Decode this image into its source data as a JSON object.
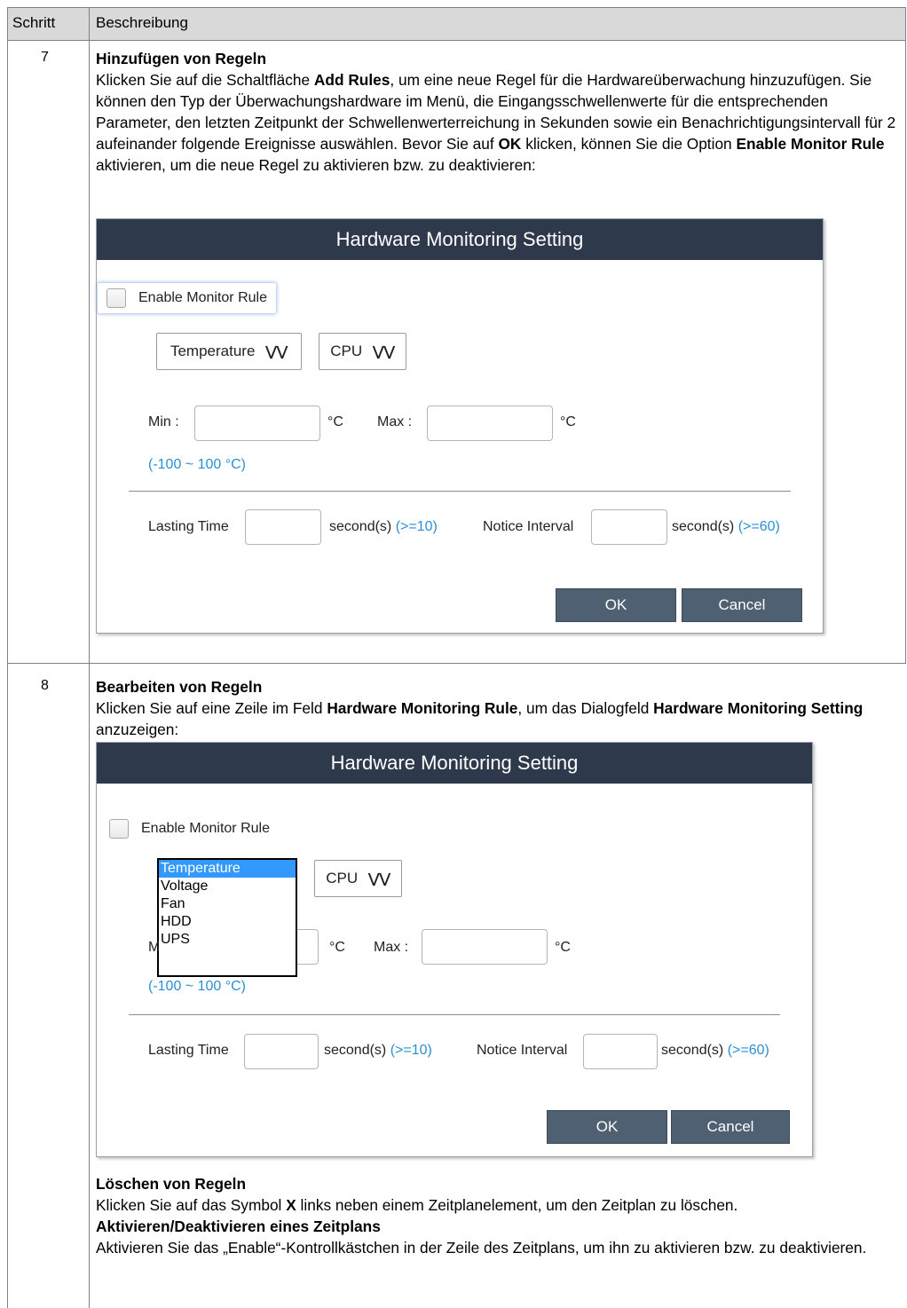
{
  "table": {
    "col_step": "Schritt",
    "col_desc": "Beschreibung"
  },
  "rows": [
    {
      "step": "7",
      "heading": "Hinzufügen von Regeln",
      "p1": "Klicken Sie auf die Schaltfläche ",
      "b1": "Add Rules",
      "p2": ", um eine neue Regel für die Hardwareüberwachung hinzuzufügen. Sie können den Typ der Überwachungshardware im Menü, die Eingangsschwellenwerte für die entsprechenden Parameter, den letzten Zeitpunkt der Schwellenwerterreichung in Sekunden sowie ein Benachrichtigungsintervall für 2 aufeinander folgende Ereignisse auswählen. Bevor Sie auf ",
      "b2": "OK",
      "p3": " klicken, können Sie die Option ",
      "b3": "Enable Monitor Rule",
      "p4": " aktivieren, um die neue Regel zu aktivieren bzw. zu deaktivieren:"
    },
    {
      "step": "8",
      "heading": "Bearbeiten von Regeln",
      "p1": "Klicken Sie auf eine Zeile im Feld ",
      "b1": "Hardware Monitoring Rule",
      "p2": ", um das Dialogfeld ",
      "b2": "Hardware Monitoring Setting",
      "p3": " anzuzeigen:",
      "heading2": "Löschen von Regeln",
      "q1": "Klicken Sie auf das Symbol ",
      "qb": "X",
      "q2": " links neben einem Zeitplanelement, um den Zeitplan zu löschen.",
      "heading3": "Aktivieren/Deaktivieren eines Zeitplans",
      "r1": "Aktivieren Sie das „Enable“-Kontrollkästchen in der Zeile des Zeitplans, um ihn zu aktivieren bzw. zu deaktivieren."
    }
  ],
  "dialog": {
    "title": "Hardware Monitoring Setting",
    "enable_label": "Enable Monitor Rule",
    "type_value": "Temperature",
    "target_value": "CPU",
    "min_label": "Min :",
    "max_label": "Max :",
    "unit": "°C",
    "range_hint": "(-100 ~ 100 °C)",
    "lasting_label": "Lasting Time",
    "seconds": "second(s)",
    "lasting_hint": "(>=10)",
    "notice_label": "Notice Interval",
    "notice_hint": "(>=60)",
    "ok": "OK",
    "cancel": "Cancel",
    "type_options": [
      "Temperature",
      "Voltage",
      "Fan",
      "HDD",
      "UPS"
    ]
  },
  "colors": {
    "title_bar": "#2e3a4c",
    "button": "#4f6072",
    "hint": "#2a8fd6",
    "header_bg": "#d9d9d9"
  }
}
